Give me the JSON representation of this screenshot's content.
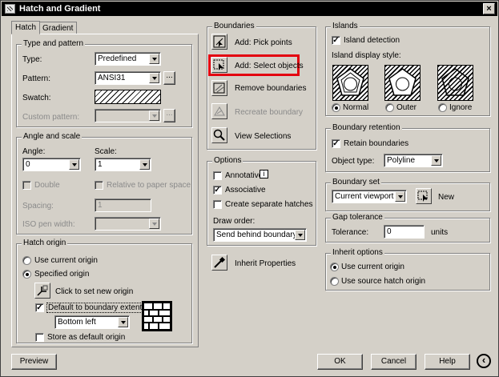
{
  "window": {
    "title": "Hatch and Gradient",
    "close_glyph": "×"
  },
  "tabs": [
    {
      "label": "Hatch"
    },
    {
      "label": "Gradient"
    }
  ],
  "type_pattern": {
    "group_title": "Type and pattern",
    "type_label": "Type:",
    "type_value": "Predefined",
    "pattern_label": "Pattern:",
    "pattern_value": "ANSI31",
    "pattern_browse": "...",
    "swatch_label": "Swatch:",
    "custom_pattern_label": "Custom pattern:",
    "custom_browse": "..."
  },
  "angle_scale": {
    "group_title": "Angle and scale",
    "angle_label": "Angle:",
    "angle_value": "0",
    "scale_label": "Scale:",
    "scale_value": "1",
    "double_label": "Double",
    "relative_label": "Relative to paper space",
    "spacing_label": "Spacing:",
    "spacing_value": "1",
    "iso_label": "ISO pen width:"
  },
  "hatch_origin": {
    "group_title": "Hatch origin",
    "use_current_label": "Use current origin",
    "specified_label": "Specified origin",
    "click_label": "Click to set new origin",
    "default_boundary_label": "Default to boundary extents",
    "default_boundary_checked": true,
    "position_value": "Bottom left",
    "store_label": "Store as default origin",
    "selected": "specified"
  },
  "boundaries": {
    "group_title": "Boundaries",
    "pick_points": "Add: Pick points",
    "select_objects": "Add: Select objects",
    "remove": "Remove boundaries",
    "recreate": "Recreate boundary",
    "view": "View Selections",
    "highlight_color": "#e3000f"
  },
  "options": {
    "group_title": "Options",
    "annotative_label": "Annotative",
    "info_glyph": "i",
    "associative_label": "Associative",
    "associative_checked": true,
    "separate_label": "Create separate hatches",
    "draw_order_label": "Draw order:",
    "draw_order_value": "Send behind boundary"
  },
  "inherit_label": "Inherit Properties",
  "islands": {
    "group_title": "Islands",
    "detection_label": "Island detection",
    "detection_checked": true,
    "style_label": "Island display style:",
    "normal_label": "Normal",
    "outer_label": "Outer",
    "ignore_label": "Ignore",
    "selected": "normal"
  },
  "retention": {
    "group_title": "Boundary retention",
    "retain_label": "Retain boundaries",
    "retain_checked": true,
    "object_type_label": "Object type:",
    "object_type_value": "Polyline"
  },
  "boundary_set": {
    "group_title": "Boundary set",
    "value": "Current viewport",
    "new_label": "New"
  },
  "gap": {
    "group_title": "Gap tolerance",
    "tolerance_label": "Tolerance:",
    "tolerance_value": "0",
    "units_label": "units"
  },
  "inherit_options": {
    "group_title": "Inherit options",
    "use_current_label": "Use current origin",
    "use_source_label": "Use source hatch origin",
    "selected": "use_current"
  },
  "footer": {
    "preview": "Preview",
    "ok": "OK",
    "cancel": "Cancel",
    "help": "Help",
    "expand_glyph": "‹"
  }
}
